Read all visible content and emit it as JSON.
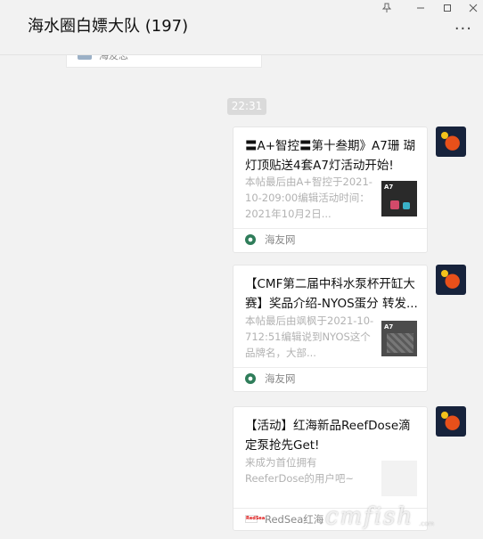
{
  "window": {
    "title": "海水圈白嫖大队 (197)",
    "pin_icon": "pin-icon",
    "min_icon": "minimize-icon",
    "max_icon": "maximize-icon",
    "close_icon": "close-icon",
    "more_icon": "more-icon"
  },
  "chat": {
    "previous_card": {
      "source": "海友志"
    },
    "timestamp": "22:31",
    "messages": [
      {
        "title": "〓A+智控〓第十叁期》A7珊 瑚灯顶贴送4套A7灯活动开始!",
        "desc": "本帖最后由A+智控于2021-10-209:00编辑活动时间：2021年10月2日...",
        "thumb_label": "A7",
        "source": "海友网"
      },
      {
        "title": "【CMF第二届中科水泵杯开缸大赛】奖品介绍-NYOS蛋分 转发...",
        "desc": "本帖最后由飒枫于2021-10-712:51编辑说到NYOS这个品牌名，大部...",
        "thumb_label": "A7",
        "source": "海友网"
      },
      {
        "title": "【活动】红海新品ReefDose滴定泵抢先Get!",
        "desc": "来成为首位拥有ReeferDose的用户吧~",
        "source_logo": "RedSea",
        "source": "RedSea红海"
      }
    ]
  },
  "watermark": {
    "text": "cmfish",
    "sub": ".com"
  }
}
